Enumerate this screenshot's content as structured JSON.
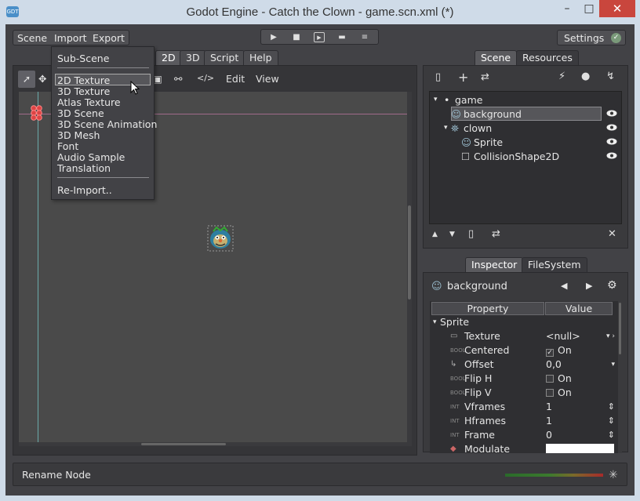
{
  "window": {
    "title": "Godot Engine - Catch the Clown - game.scn.xml (*)",
    "min_glyph": "–",
    "max_glyph": "□",
    "close_glyph": "✕",
    "app_icon_text": "GDT"
  },
  "menubar": {
    "scene": "Scene",
    "import": "Import",
    "export": "Export"
  },
  "playbar": {
    "play": "▶",
    "stop": "■",
    "play_scene": "▶",
    "open": "▬",
    "more": "≡"
  },
  "settings": {
    "label": "Settings",
    "icon": "check-circle-icon",
    "glyph": "✓"
  },
  "editor_tabs": {
    "d2": "2D",
    "d3": "3D",
    "script": "Script",
    "help": "Help"
  },
  "viewport_toolbar": {
    "select_glyph": "➚",
    "move_glyph": "✥",
    "lock_glyph": "▣",
    "group_glyph": "⚯",
    "code_glyph": "</>",
    "edit": "Edit",
    "view": "View"
  },
  "import_menu": {
    "items": [
      "Sub-Scene",
      "2D Texture",
      "3D Texture",
      "Atlas Texture",
      "3D Scene",
      "3D Scene Animation",
      "3D Mesh",
      "Font",
      "Audio Sample",
      "Translation",
      "Re-Import.."
    ],
    "highlighted": "2D Texture"
  },
  "scene_dock": {
    "tabs": {
      "scene": "Scene",
      "resources": "Resources"
    },
    "toolbar": {
      "new_glyph": "▯",
      "add_glyph": "+",
      "replace_glyph": "⇄",
      "connect_glyph": "⚡",
      "groups_glyph": "●",
      "script_glyph": "↯"
    },
    "tree": [
      {
        "label": "game",
        "icon": "node-icon",
        "glyph": "•",
        "expand": "▾"
      },
      {
        "label": "background",
        "icon": "sprite-icon",
        "glyph": "☺",
        "selected": true
      },
      {
        "label": "clown",
        "icon": "area-icon",
        "glyph": "⛯",
        "expand": "▾"
      },
      {
        "label": "Sprite",
        "icon": "sprite-icon",
        "glyph": "☺"
      },
      {
        "label": "CollisionShape2D",
        "icon": "shape-icon",
        "glyph": "☐"
      }
    ],
    "bottom": {
      "up": "▲",
      "down": "▼",
      "dup": "▯",
      "reparent": "⇄",
      "delete": "✕"
    }
  },
  "inspector_dock": {
    "tabs": {
      "inspector": "Inspector",
      "filesystem": "FileSystem"
    },
    "header": {
      "name": "background",
      "icon_glyph": "☺",
      "back": "◀",
      "fwd": "▶",
      "gear": "⚙"
    },
    "columns": {
      "property": "Property",
      "value": "Value"
    },
    "section": "Sprite",
    "section_arrow": "▾",
    "rows": [
      {
        "type": "▭",
        "name": "Texture",
        "value": "<null>",
        "arrow": "▾ ›"
      },
      {
        "type": "BOOL",
        "name": "Centered",
        "value": "On",
        "checked": true,
        "check_glyph": "✓"
      },
      {
        "type": "↳",
        "name": "Offset",
        "value": "0,0",
        "arrow": "▾"
      },
      {
        "type": "BOOL",
        "name": "Flip H",
        "value": "On",
        "checked": false
      },
      {
        "type": "BOOL",
        "name": "Flip V",
        "value": "On",
        "checked": false
      },
      {
        "type": "INT",
        "name": "Vframes",
        "value": "1",
        "arrow": "⇕"
      },
      {
        "type": "INT",
        "name": "Hframes",
        "value": "1",
        "arrow": "⇕"
      },
      {
        "type": "INT",
        "name": "Frame",
        "value": "0",
        "arrow": "⇕"
      },
      {
        "type": "◆",
        "name": "Modulate",
        "value": ""
      }
    ]
  },
  "status": {
    "label": "Rename Node",
    "spinner": "✳"
  },
  "colors": {
    "panel": "#424246",
    "dock": "#3a3a3d",
    "viewport": "#4a4a4a",
    "accent_close": "#c9463d",
    "titlebar": "#cfdbe8"
  }
}
